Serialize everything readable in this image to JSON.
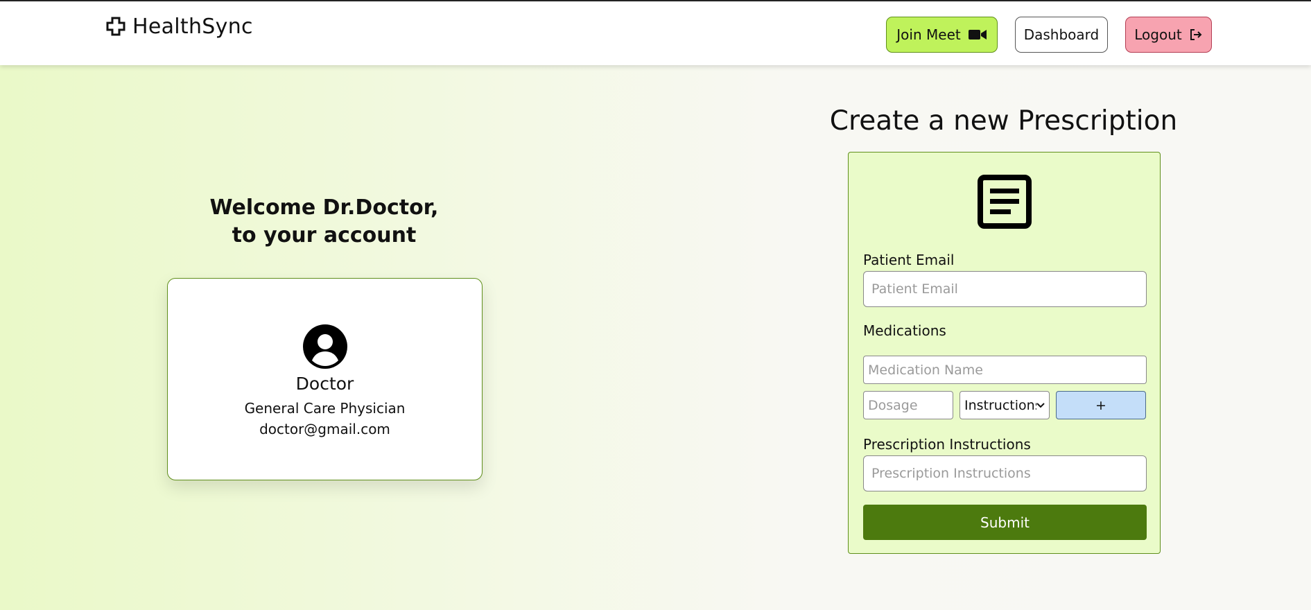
{
  "brand": {
    "name": "HealthSync",
    "icon": "medical-cross-icon"
  },
  "nav": {
    "join_meet": "Join Meet",
    "dashboard": "Dashboard",
    "logout": "Logout"
  },
  "welcome": {
    "line1": "Welcome Dr.Doctor,",
    "line2": "to your account"
  },
  "doctor": {
    "name": "Doctor",
    "role": "General Care Physician",
    "email": "doctor@gmail.com"
  },
  "form": {
    "title": "Create a new Prescription",
    "patient_email_label": "Patient Email",
    "patient_email_placeholder": "Patient Email",
    "medications_label": "Medications",
    "medication_name_placeholder": "Medication Name",
    "dosage_placeholder": "Dosage",
    "instructions_select": "Instructions",
    "add_label": "+",
    "prescription_instructions_label": "Prescription Instructions",
    "prescription_instructions_placeholder": "Prescription Instructions",
    "submit_label": "Submit"
  },
  "colors": {
    "join_meet_bg": "#bff25b",
    "logout_bg": "#f7a3b0",
    "form_bg": "#eafbc9",
    "submit_bg": "#4c7a0e",
    "add_bg": "#c4def9"
  }
}
